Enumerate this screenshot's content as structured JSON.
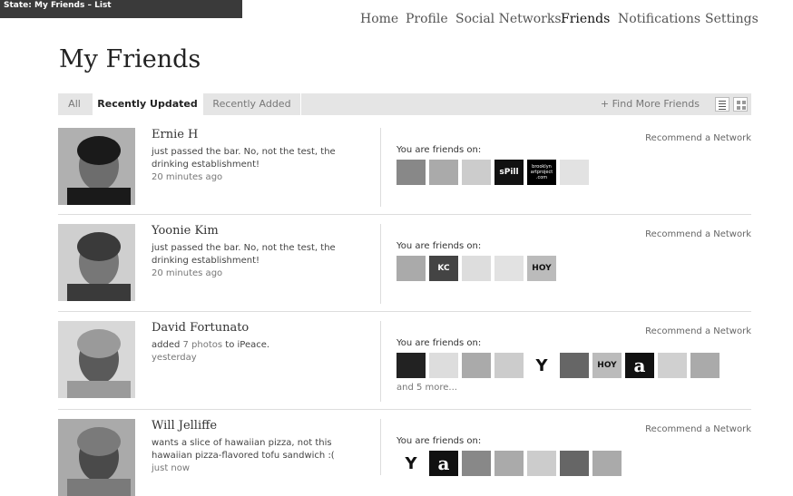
{
  "state_label": "State: My Friends – List",
  "nav": [
    {
      "label": "Home",
      "active": false
    },
    {
      "label": "Profile",
      "active": false
    },
    {
      "label": "Social Networks",
      "active": false
    },
    {
      "label": "Friends",
      "active": true
    },
    {
      "label": "Notifications",
      "active": false
    },
    {
      "label": "Settings",
      "active": false
    }
  ],
  "page_title": "My Friends",
  "tabs": [
    {
      "label": "All",
      "active": false
    },
    {
      "label": "Recently Updated",
      "active": true
    },
    {
      "label": "Recently Added",
      "active": false
    }
  ],
  "find_more": "+ Find More Friends",
  "friends_on_label": "You are friends on:",
  "recommend_label": "Recommend a Network",
  "friends": [
    {
      "name": "Ernie H",
      "status_text": "just passed the bar. No, not the test, the drinking establishment!",
      "time": "20 minutes ago",
      "networks": [
        "speedy-icon",
        "truck-icon",
        "badge-icon",
        "spill-icon",
        "brooklyn-icon",
        "pattern-icon"
      ],
      "network_labels": [
        "",
        "",
        "",
        "sPill",
        "brooklyn artproject .com",
        ""
      ]
    },
    {
      "name": "Yoonie Kim",
      "status_text": "just passed the bar. No, not the test, the drinking establishment!",
      "time": "20 minutes ago",
      "networks": [
        "truck-icon",
        "kc-icon",
        "helmet-icon",
        "pattern-icon",
        "hoy-icon"
      ],
      "network_labels": [
        "",
        "KC",
        "",
        "",
        "HOY"
      ]
    },
    {
      "name": "David Fortunato",
      "status_prefix": "added ",
      "status_link": "7 photos",
      "status_suffix": " to iPeace.",
      "time": "yesterday",
      "networks": [
        "dark-photo-icon",
        "helmet-icon",
        "truck-icon",
        "badge-icon",
        "y-icon",
        "photo-icon",
        "hoy-icon",
        "a-icon",
        "city-icon",
        "truck-icon"
      ],
      "network_labels": [
        "",
        "",
        "",
        "",
        "Y",
        "",
        "HOY",
        "a",
        "",
        ""
      ],
      "and_more": "and 5 more..."
    },
    {
      "name": "Will Jelliffe",
      "status_text": "wants a slice of hawaiian pizza, not this hawaiian pizza-flavored tofu sandwich :(",
      "time": "just now",
      "networks": [
        "y-icon",
        "a-icon",
        "speedy-icon",
        "truck-icon",
        "badge-icon",
        "photo-icon",
        "truck-icon"
      ],
      "network_labels": [
        "Y",
        "a",
        "",
        "",
        "",
        "",
        ""
      ]
    }
  ]
}
